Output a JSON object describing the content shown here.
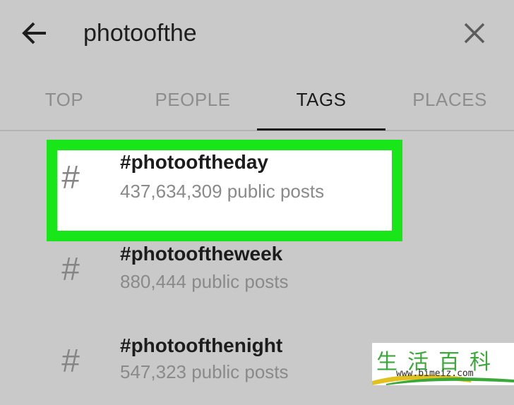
{
  "search": {
    "value": "photoofthe",
    "back_icon": "arrow-left-icon",
    "clear_icon": "close-icon"
  },
  "tabs": [
    {
      "label": "TOP",
      "active": false
    },
    {
      "label": "PEOPLE",
      "active": false
    },
    {
      "label": "TAGS",
      "active": true
    },
    {
      "label": "PLACES",
      "active": false
    }
  ],
  "results": [
    {
      "symbol": "#",
      "name": "#photooftheday",
      "count": "437,634,309 public posts",
      "highlighted": true
    },
    {
      "symbol": "#",
      "name": "#photooftheweek",
      "count": "880,444 public posts",
      "highlighted": false
    },
    {
      "symbol": "#",
      "name": "#photoofthenight",
      "count": "547,323 public posts",
      "highlighted": false
    }
  ],
  "watermark": {
    "chars": "生活百科",
    "url": "www.bimeiz.com"
  },
  "colors": {
    "background": "#c9c9c9",
    "highlight": "#19e619",
    "text_primary": "#1c1c1c",
    "text_secondary": "#8a8a8a"
  }
}
